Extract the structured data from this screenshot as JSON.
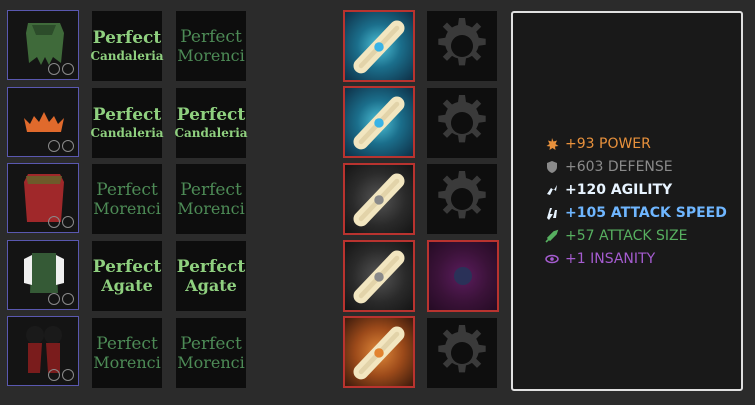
{
  "rows": [
    {
      "item": "green tattered cloak",
      "gem1": {
        "line1": "Perfect",
        "line2": "Candaleria"
      },
      "gem2": {
        "line1": "Perfect",
        "line2": "Morenci"
      },
      "enchant": "blue scroll",
      "modifier": "empty gear slot"
    },
    {
      "item": "orange horned circlet",
      "gem1": {
        "line1": "Perfect",
        "line2": "Candaleria"
      },
      "gem2": {
        "line1": "Perfect",
        "line2": "Candaleria"
      },
      "enchant": "blue scroll",
      "modifier": "empty gear slot"
    },
    {
      "item": "red caped tunic",
      "gem1": {
        "line1": "Perfect",
        "line2": "Morenci"
      },
      "gem2": {
        "line1": "Perfect",
        "line2": "Morenci"
      },
      "enchant": "white scroll",
      "modifier": "empty gear slot"
    },
    {
      "item": "green vest with white sleeves",
      "gem1": {
        "line1": "Perfect",
        "line2": "Agate"
      },
      "gem2": {
        "line1": "Perfect",
        "line2": "Agate"
      },
      "enchant": "white scroll",
      "modifier": "dark purple orb"
    },
    {
      "item": "red armored leggings",
      "gem1": {
        "line1": "Perfect",
        "line2": "Morenci"
      },
      "gem2": {
        "line1": "Perfect",
        "line2": "Morenci"
      },
      "enchant": "orange scroll",
      "modifier": "empty gear slot"
    }
  ],
  "stats": [
    {
      "text": "+93 POWER",
      "color": "#e8913c",
      "icon": "power-icon"
    },
    {
      "text": "+603 DEFENSE",
      "color": "#8a8a8a",
      "icon": "shield-icon"
    },
    {
      "text": "+120 AGILITY",
      "color": "#e8f4ff",
      "icon": "agility-icon"
    },
    {
      "text": "+105 ATTACK SPEED",
      "color": "#6fb6ff",
      "icon": "attack-speed-icon"
    },
    {
      "text": "+57 ATTACK SIZE",
      "color": "#57b060",
      "icon": "attack-size-icon"
    },
    {
      "text": "+1 INSANITY",
      "color": "#a55cd0",
      "icon": "insanity-icon"
    }
  ],
  "colors": {
    "background": "#2b2b2b",
    "slot_border": "#5a58b0",
    "enchant_border": "#b9332f",
    "gem_text": "#8fd07f"
  }
}
